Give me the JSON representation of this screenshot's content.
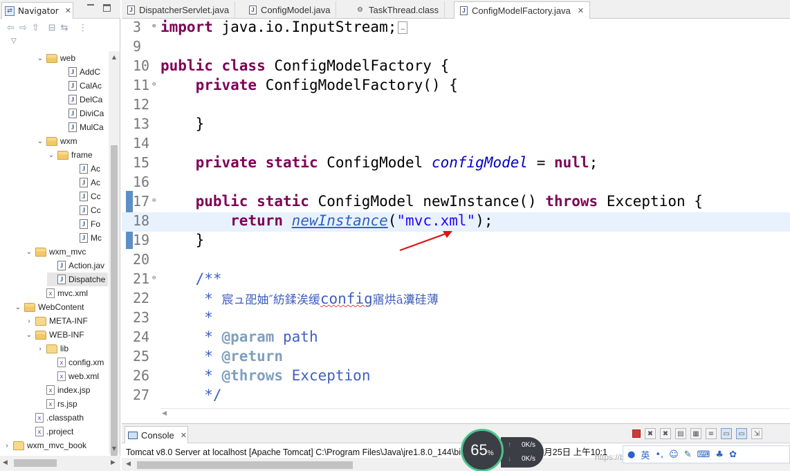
{
  "navigator": {
    "tab_label": "Navigator",
    "tree": [
      {
        "label": "web",
        "depth": 4,
        "kind": "folder",
        "expanded": true
      },
      {
        "label": "AddC",
        "depth": 6,
        "kind": "java"
      },
      {
        "label": "CalAc",
        "depth": 6,
        "kind": "java"
      },
      {
        "label": "DelCa",
        "depth": 6,
        "kind": "java"
      },
      {
        "label": "DiviCa",
        "depth": 6,
        "kind": "java"
      },
      {
        "label": "MulCa",
        "depth": 6,
        "kind": "java"
      },
      {
        "label": "wxm",
        "depth": 4,
        "kind": "folder",
        "expanded": true
      },
      {
        "label": "frame",
        "depth": 5,
        "kind": "folder",
        "expanded": true
      },
      {
        "label": "Ac",
        "depth": 7,
        "kind": "java"
      },
      {
        "label": "Ac",
        "depth": 7,
        "kind": "java"
      },
      {
        "label": "Cc",
        "depth": 7,
        "kind": "java"
      },
      {
        "label": "Cc",
        "depth": 7,
        "kind": "java"
      },
      {
        "label": "Fo",
        "depth": 7,
        "kind": "java"
      },
      {
        "label": "Mc",
        "depth": 7,
        "kind": "java"
      },
      {
        "label": "wxm_mvc",
        "depth": 3,
        "kind": "folder",
        "expanded": true
      },
      {
        "label": "Action.jav",
        "depth": 5,
        "kind": "java"
      },
      {
        "label": "Dispatche",
        "depth": 5,
        "kind": "java",
        "selected": true
      },
      {
        "label": "mvc.xml",
        "depth": 4,
        "kind": "xml"
      },
      {
        "label": "WebContent",
        "depth": 2,
        "kind": "folder",
        "expanded": true
      },
      {
        "label": "META-INF",
        "depth": 3,
        "kind": "folder",
        "expanded": false
      },
      {
        "label": "WEB-INF",
        "depth": 3,
        "kind": "folder",
        "expanded": true
      },
      {
        "label": "lib",
        "depth": 4,
        "kind": "folder",
        "expanded": false
      },
      {
        "label": "config.xm",
        "depth": 5,
        "kind": "xml"
      },
      {
        "label": "web.xml",
        "depth": 5,
        "kind": "xml"
      },
      {
        "label": "index.jsp",
        "depth": 4,
        "kind": "xml"
      },
      {
        "label": "rs.jsp",
        "depth": 4,
        "kind": "xml"
      },
      {
        "label": ".classpath",
        "depth": 3,
        "kind": "xml"
      },
      {
        "label": ".project",
        "depth": 3,
        "kind": "xml"
      },
      {
        "label": "wxm_mvc_book",
        "depth": 1,
        "kind": "folder",
        "expanded": false
      }
    ]
  },
  "editor": {
    "tabs": [
      {
        "label": "DispatcherServlet.java",
        "icon": "java-file-icon",
        "active": false
      },
      {
        "label": "ConfigModel.java",
        "icon": "java-file-icon",
        "active": false
      },
      {
        "label": "TaskThread.class",
        "icon": "class-file-icon",
        "active": false
      },
      {
        "label": "ConfigModelFactory.java",
        "icon": "java-file-icon",
        "active": true
      }
    ],
    "lines": [
      {
        "n": "3",
        "fold": "⊕",
        "html": "<span class=\"kw\">import</span> java.io.InputStream;<span class=\"boxglyph\">…</span>"
      },
      {
        "n": "9",
        "fold": "",
        "html": ""
      },
      {
        "n": "10",
        "fold": "",
        "html": "<span class=\"kw\">public class</span> ConfigModelFactory {"
      },
      {
        "n": "11",
        "fold": "⊖",
        "html": "    <span class=\"kw\">private</span> ConfigModelFactory() {"
      },
      {
        "n": "12",
        "fold": "",
        "html": ""
      },
      {
        "n": "13",
        "fold": "",
        "html": "    }"
      },
      {
        "n": "14",
        "fold": "",
        "html": ""
      },
      {
        "n": "15",
        "fold": "",
        "html": "    <span class=\"kw\">private static</span> ConfigModel <span class=\"fld\">configModel</span> = <span class=\"kw\">null</span>;"
      },
      {
        "n": "16",
        "fold": "",
        "html": ""
      },
      {
        "n": "17",
        "fold": "⊖",
        "html": "    <span class=\"kw\">public static</span> ConfigModel newInstance() <span class=\"kw\">throws</span> Exception {"
      },
      {
        "n": "18",
        "fold": "",
        "html": "        <span class=\"kw\">return</span> <span class=\"mcall link fld\">newInstance</span>(<span class=\"str\">\"mvc.xml\"</span>);",
        "highlight": true
      },
      {
        "n": "19",
        "fold": "",
        "html": "    }"
      },
      {
        "n": "20",
        "fold": "",
        "html": ""
      },
      {
        "n": "21",
        "fold": "⊖",
        "html": "    <span class=\"cmt\">/**</span>"
      },
      {
        "n": "22",
        "fold": "",
        "html": "     <span class=\"cmt\">* </span><span class=\"cjk\">宸ュ巶妯″紡鍒涘缓</span><span class=\"cmt squig\">config</span><span class=\"cjk\">寤烘ā瀵硅薄</span>"
      },
      {
        "n": "23",
        "fold": "",
        "html": "     <span class=\"cmt\">*</span>"
      },
      {
        "n": "24",
        "fold": "",
        "html": "     <span class=\"cmt\">* <span class=\"cmt-tag\">@param</span> path</span>"
      },
      {
        "n": "25",
        "fold": "",
        "html": "     <span class=\"cmt\">* <span class=\"cmt-tag\">@return</span></span>"
      },
      {
        "n": "26",
        "fold": "",
        "html": "     <span class=\"cmt\">* <span class=\"cmt-tag\">@throws</span> Exception</span>"
      },
      {
        "n": "27",
        "fold": "",
        "html": "     <span class=\"cmt\">*/</span>"
      }
    ]
  },
  "console": {
    "tab_label": "Console",
    "description": "Tomcat v8.0 Server at localhost [Apache Tomcat] C:\\Program Files\\Java\\jre1.8.0_144\\bin\\javaw.exe (2019年7月25日 上午10:1"
  },
  "net_widget": {
    "percent": "65",
    "percent_unit": "%",
    "up": "0K/s",
    "down": "0K/s"
  },
  "watermark": "https://blog.csdn.net/weixin_44105334",
  "ime": {
    "mode_label": "英"
  }
}
